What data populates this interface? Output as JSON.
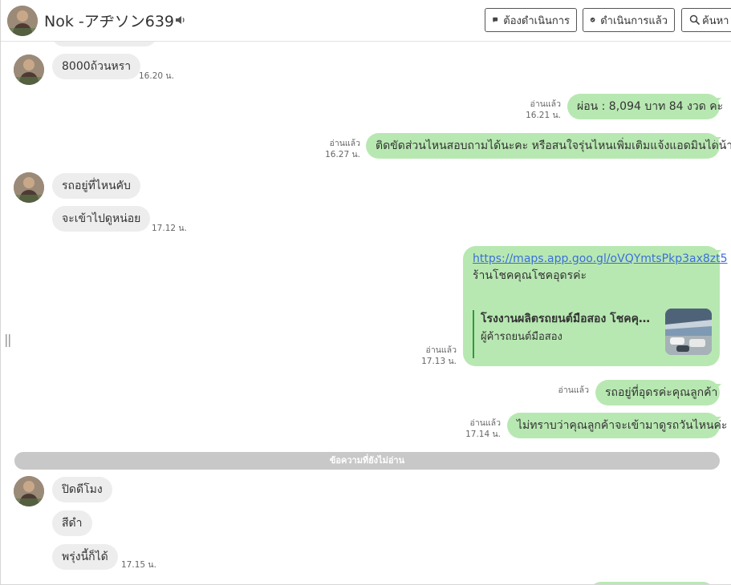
{
  "header": {
    "contact_name": "Nok -アヂソン639",
    "buttons": {
      "todo": "ต้องดำเนินการ",
      "done": "ดำเนินการแล้ว",
      "search": "ค้นหา"
    }
  },
  "messages": {
    "m1": {
      "text": "8000ถ้วนหรา",
      "time": "16.20 น."
    },
    "m2": {
      "read": "อ่านแล้ว",
      "time": "16.21 น.",
      "text": "ผ่อน : 8,094 บาท 84 งวด  ค่ะ"
    },
    "m3": {
      "read": "อ่านแล้ว",
      "time": "16.27 น.",
      "text": "ติดขัดส่วนไหนสอบถามได้นะคะ หรือสนใจรุ่นไหนเพิ่มเติมแจ้งแอดมินได้น้า"
    },
    "m4": {
      "text": "รถอยู่ที่ไหนคับ"
    },
    "m5": {
      "text": "จะเข้าไปดูหน่อย",
      "time": "17.12 น."
    },
    "m6": {
      "read": "อ่านแล้ว",
      "time": "17.13 น.",
      "url": "https://maps.app.goo.gl/oVQYmtsPkp3ax8zt5",
      "caption": "ร้านโชคคุณโชคอุดรค่ะ",
      "preview_title": "โรงงานผลิตรถยนต์มือสอง โชคคุณโชค",
      "preview_subtitle": "ผู้ค้ารถยนต์มือสอง"
    },
    "m7": {
      "read": "อ่านแล้ว",
      "text": "รถอยู่ที่อุดรค่ะคุณลูกค้า"
    },
    "m8": {
      "read": "อ่านแล้ว",
      "time": "17.14 น.",
      "text": "ไม่ทราบว่าคุณลูกค้าจะเข้ามาดูรถวันไหนค่ะ"
    },
    "unread_divider": "ข้อความที่ยังไม่อ่าน",
    "m9": {
      "text": "ปิดดีโมง"
    },
    "m10": {
      "text": "สีดำ"
    },
    "m11": {
      "text": "พรุ่งนี้ก็ได้",
      "time": "17.15 น."
    }
  },
  "colors": {
    "incoming_bubble": "#ededed",
    "outgoing_bubble": "#b8e8b2",
    "link": "#3b6fd8",
    "divider": "#c8c8c8"
  }
}
